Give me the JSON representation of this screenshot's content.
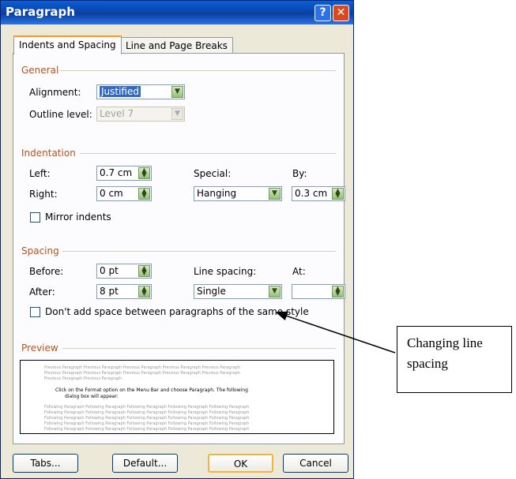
{
  "dialog": {
    "title": "Paragraph",
    "help_glyph": "?",
    "close_glyph": "✕"
  },
  "tabs": [
    {
      "label": "Indents and Spacing",
      "active": true
    },
    {
      "label": "Line and Page Breaks",
      "active": false
    }
  ],
  "general": {
    "header": "General",
    "alignment_label": "Alignment:",
    "alignment_value": "Justified",
    "outline_label": "Outline level:",
    "outline_value": "Level 7"
  },
  "indentation": {
    "header": "Indentation",
    "left_label": "Left:",
    "left_value": "0.7 cm",
    "right_label": "Right:",
    "right_value": "0 cm",
    "special_label": "Special:",
    "special_value": "Hanging",
    "by_label": "By:",
    "by_value": "0.3 cm",
    "mirror_label": "Mirror indents",
    "mirror_checked": false
  },
  "spacing": {
    "header": "Spacing",
    "before_label": "Before:",
    "before_value": "0 pt",
    "after_label": "After:",
    "after_value": "8 pt",
    "line_spacing_label": "Line spacing:",
    "line_spacing_value": "Single",
    "at_label": "At:",
    "at_value": "",
    "dont_add_label": "Don't add space between paragraphs of the same style",
    "dont_add_checked": false
  },
  "preview": {
    "header": "Preview",
    "prev_lines": [
      "Previous Paragraph Previous Paragraph Previous Paragraph Previous Paragraph Previous Paragraph",
      "Previous Paragraph Previous Paragraph Previous Paragraph Previous Paragraph Previous Paragraph",
      "Previous Paragraph Previous Paragraph"
    ],
    "main_lines": [
      "Click on the Format option on the Menu Bar and choose Paragraph. The following",
      "dialog box will appear:"
    ],
    "next_lines": [
      "Following Paragraph Following Paragraph Following Paragraph Following Paragraph Following Paragraph",
      "Following Paragraph Following Paragraph Following Paragraph Following Paragraph Following Paragraph",
      "Following Paragraph Following Paragraph Following Paragraph Following Paragraph Following Paragraph",
      "Following Paragraph Following Paragraph Following Paragraph Following Paragraph Following Paragraph",
      "Following Paragraph Following Paragraph Following Paragraph Following Paragraph Following Paragraph"
    ]
  },
  "buttons": {
    "tabs": "Tabs...",
    "default": "Default...",
    "ok": "OK",
    "cancel": "Cancel"
  },
  "annotation": {
    "text": "Changing line spacing"
  }
}
